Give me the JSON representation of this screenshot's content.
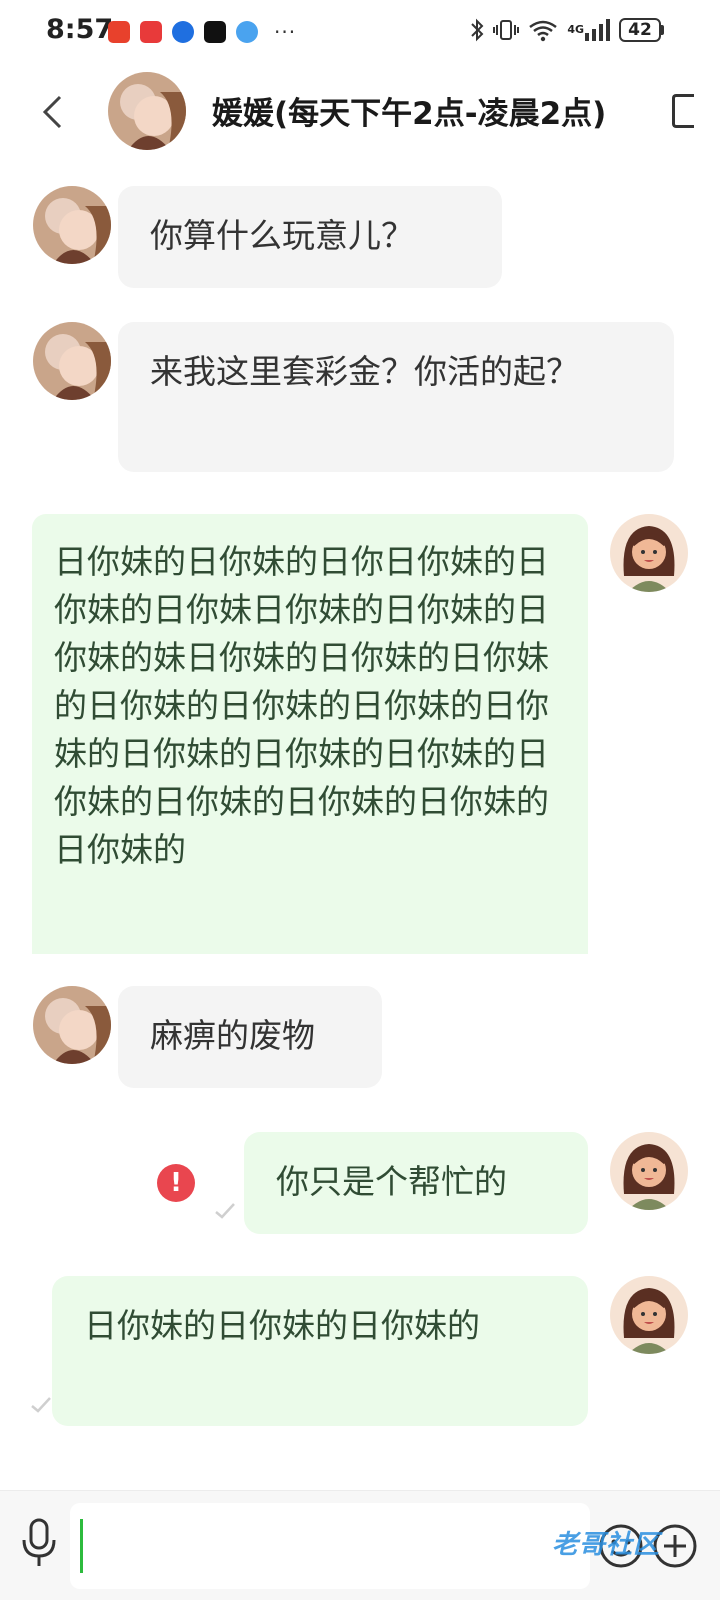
{
  "status_bar": {
    "time": "8:57",
    "more": "···",
    "network": "4G",
    "battery": "42"
  },
  "header": {
    "title": "媛媛(每天下午2点-凌晨2点)"
  },
  "messages": [
    {
      "direction": "in",
      "text": "你算什么玩意儿？"
    },
    {
      "direction": "in",
      "text": "来我这里套彩金？你活的起？"
    },
    {
      "direction": "out",
      "text": "日你妹的日你妹的日你日你妹的日你妹的日你妹日你妹的日你妹的日你妹的妹日你妹的日你妹的日你妹的日你妹的日你妹的日你妹的日你妹的日你妹的日你妹的日你妹的日你妹的日你妹的日你妹的日你妹的日你妹的"
    },
    {
      "direction": "in",
      "text": "麻痹的废物"
    },
    {
      "direction": "out",
      "text": "你只是个帮忙的",
      "status": "failed"
    },
    {
      "direction": "out",
      "text": "日你妹的日你妹的日你妹的"
    }
  ],
  "input": {
    "value": "",
    "placeholder": ""
  },
  "watermark": "老哥社区",
  "colors": {
    "incoming_bubble": "#f4f4f4",
    "outgoing_bubble": "#ebfbea",
    "error": "#e9464f",
    "caret": "#2dbb3d"
  }
}
